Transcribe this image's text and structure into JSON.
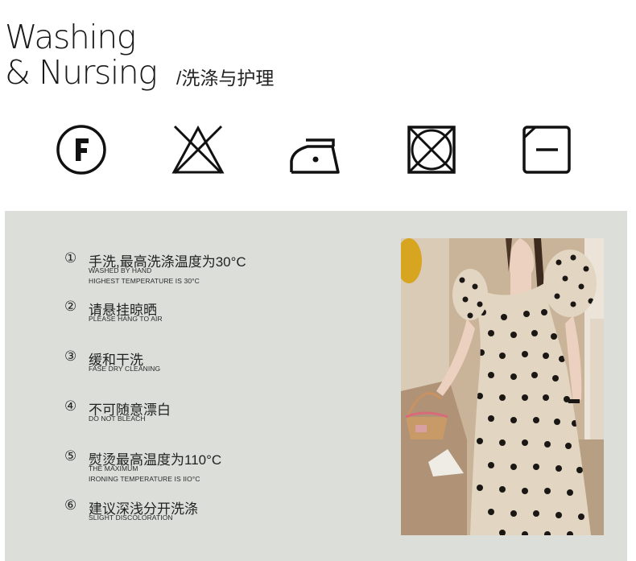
{
  "header": {
    "title_line1": "Washing",
    "title_line2": "& Nursing",
    "subtitle": "/洗涤与护理"
  },
  "care_icons": [
    "f-circle-icon",
    "no-bleach-icon",
    "iron-one-dot-icon",
    "no-tumble-dry-icon",
    "dry-flat-icon"
  ],
  "instructions": [
    {
      "num": "①",
      "cn": "手洗,最高洗涤温度为30°C",
      "en": [
        "WASHED BY HAND",
        "HIGHEST TEMPERATURE IS 30°C"
      ]
    },
    {
      "num": "②",
      "cn": "请悬挂晾晒",
      "en": [
        "PLEASE HANG TO AIR"
      ]
    },
    {
      "num": "③",
      "cn": "缓和干洗",
      "en": [
        "FASE DRY CLEANING"
      ]
    },
    {
      "num": "④",
      "cn": "不可随意漂白",
      "en": [
        "DO NOT BLEACH"
      ]
    },
    {
      "num": "⑤",
      "cn": "熨烫最高温度为110°C",
      "en": [
        "THE MAXIMUM",
        "IRONING TEMPERATURE IS IIO°C"
      ]
    },
    {
      "num": "⑥",
      "cn": "建议深浅分开洗涤",
      "en": [
        "SLIGHT DISCOLORATION"
      ]
    }
  ],
  "colors": {
    "panel_bg": "#dcdfd9",
    "dress": "#e2d5c2",
    "dots": "#1a1714"
  }
}
